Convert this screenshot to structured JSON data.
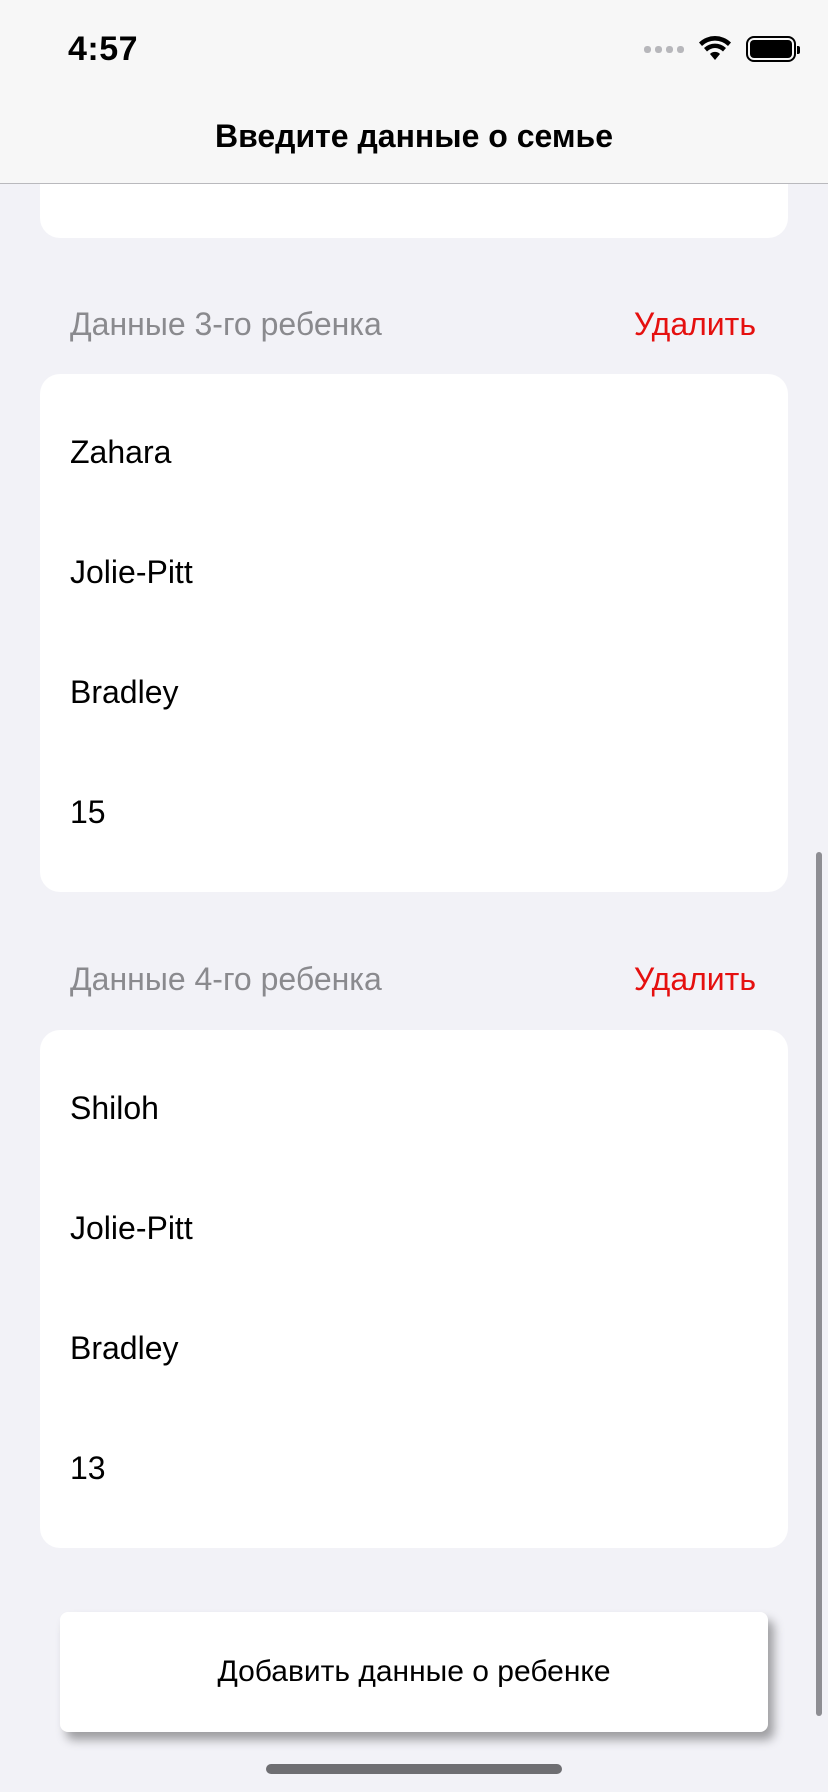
{
  "status_bar": {
    "time": "4:57"
  },
  "nav": {
    "title": "Введите данные о семье"
  },
  "children": [
    {
      "title": "Данные 3-го ребенка",
      "delete_label": "Удалить",
      "first_name": "Zahara",
      "last_name": "Jolie-Pitt",
      "middle_name": "Bradley",
      "age": "15"
    },
    {
      "title": "Данные 4-го ребенка",
      "delete_label": "Удалить",
      "first_name": "Shiloh",
      "last_name": "Jolie-Pitt",
      "middle_name": "Bradley",
      "age": "13"
    }
  ],
  "add_button": {
    "label": "Добавить данные о ребенке"
  },
  "colors": {
    "delete": "#e5100f",
    "background": "#f2f2f7",
    "section_header": "#8a8a8e"
  }
}
